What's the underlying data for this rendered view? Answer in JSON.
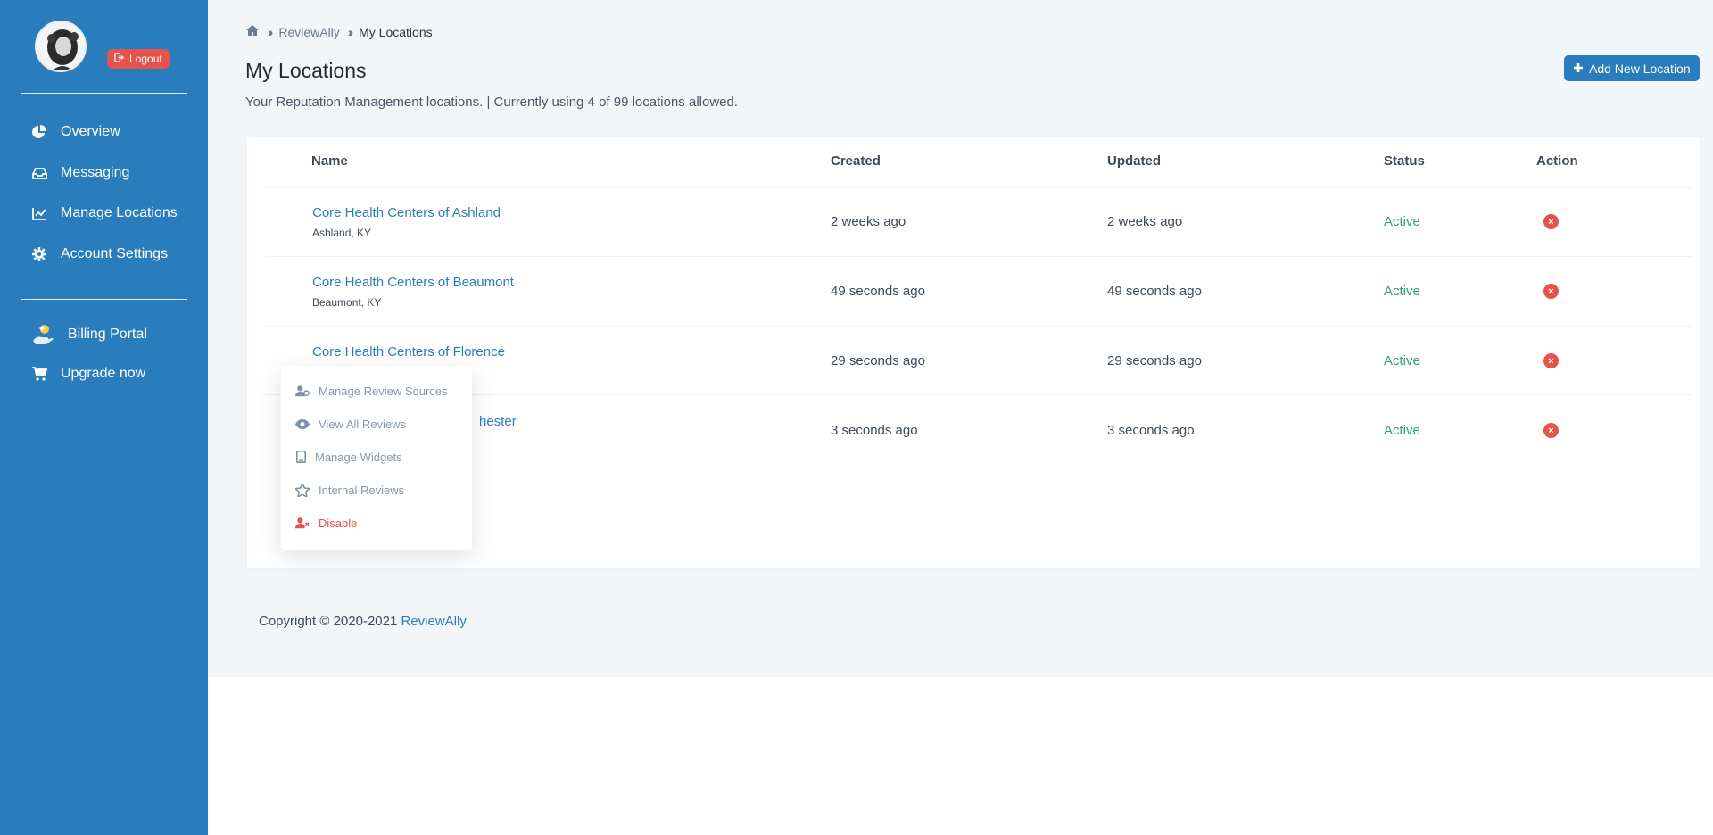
{
  "sidebar": {
    "logout_label": "Logout",
    "items": [
      {
        "label": "Overview",
        "icon": "pie-chart-icon"
      },
      {
        "label": "Messaging",
        "icon": "inbox-icon"
      },
      {
        "label": "Manage Locations",
        "icon": "line-chart-icon"
      },
      {
        "label": "Account Settings",
        "icon": "gear-icon"
      }
    ],
    "secondary_items": [
      {
        "label": "Billing Portal",
        "icon": "hand-coin-icon"
      },
      {
        "label": "Upgrade now",
        "icon": "cart-icon"
      }
    ]
  },
  "breadcrumb": {
    "root": "ReviewAlly",
    "current": "My Locations"
  },
  "header": {
    "title": "My Locations",
    "subtitle": "Your Reputation Management locations. | Currently using 4 of 99 locations allowed.",
    "add_button": "Add New Location"
  },
  "table": {
    "columns": [
      "Name",
      "Created",
      "Updated",
      "Status",
      "Action"
    ],
    "rows": [
      {
        "name": "Core Health Centers of Ashland",
        "city": "Ashland, KY",
        "created": "2 weeks ago",
        "updated": "2 weeks ago",
        "status": "Active"
      },
      {
        "name": "Core Health Centers of Beaumont",
        "city": "Beaumont, KY",
        "created": "49 seconds ago",
        "updated": "49 seconds ago",
        "status": "Active"
      },
      {
        "name": "Core Health Centers of Florence",
        "city": "",
        "created": "29 seconds ago",
        "updated": "29 seconds ago",
        "status": "Active"
      },
      {
        "name": "hester",
        "city": "",
        "created": "3 seconds ago",
        "updated": "3 seconds ago",
        "status": "Active"
      }
    ]
  },
  "dropdown": {
    "items": [
      {
        "label": "Manage Review Sources",
        "icon": "user-gear-icon"
      },
      {
        "label": "View All Reviews",
        "icon": "eye-icon"
      },
      {
        "label": "Manage Widgets",
        "icon": "tablet-icon"
      },
      {
        "label": "Internal Reviews",
        "icon": "star-icon"
      },
      {
        "label": "Disable",
        "icon": "user-x-icon"
      }
    ]
  },
  "footer": {
    "text": "Copyright © 2020-2021",
    "link": "ReviewAlly"
  },
  "colors": {
    "sidebar": "#2a7dbd",
    "accent": "#2a7dbd",
    "danger": "#e5534b",
    "success": "#2fa36b",
    "background": "#f3f6f9"
  }
}
